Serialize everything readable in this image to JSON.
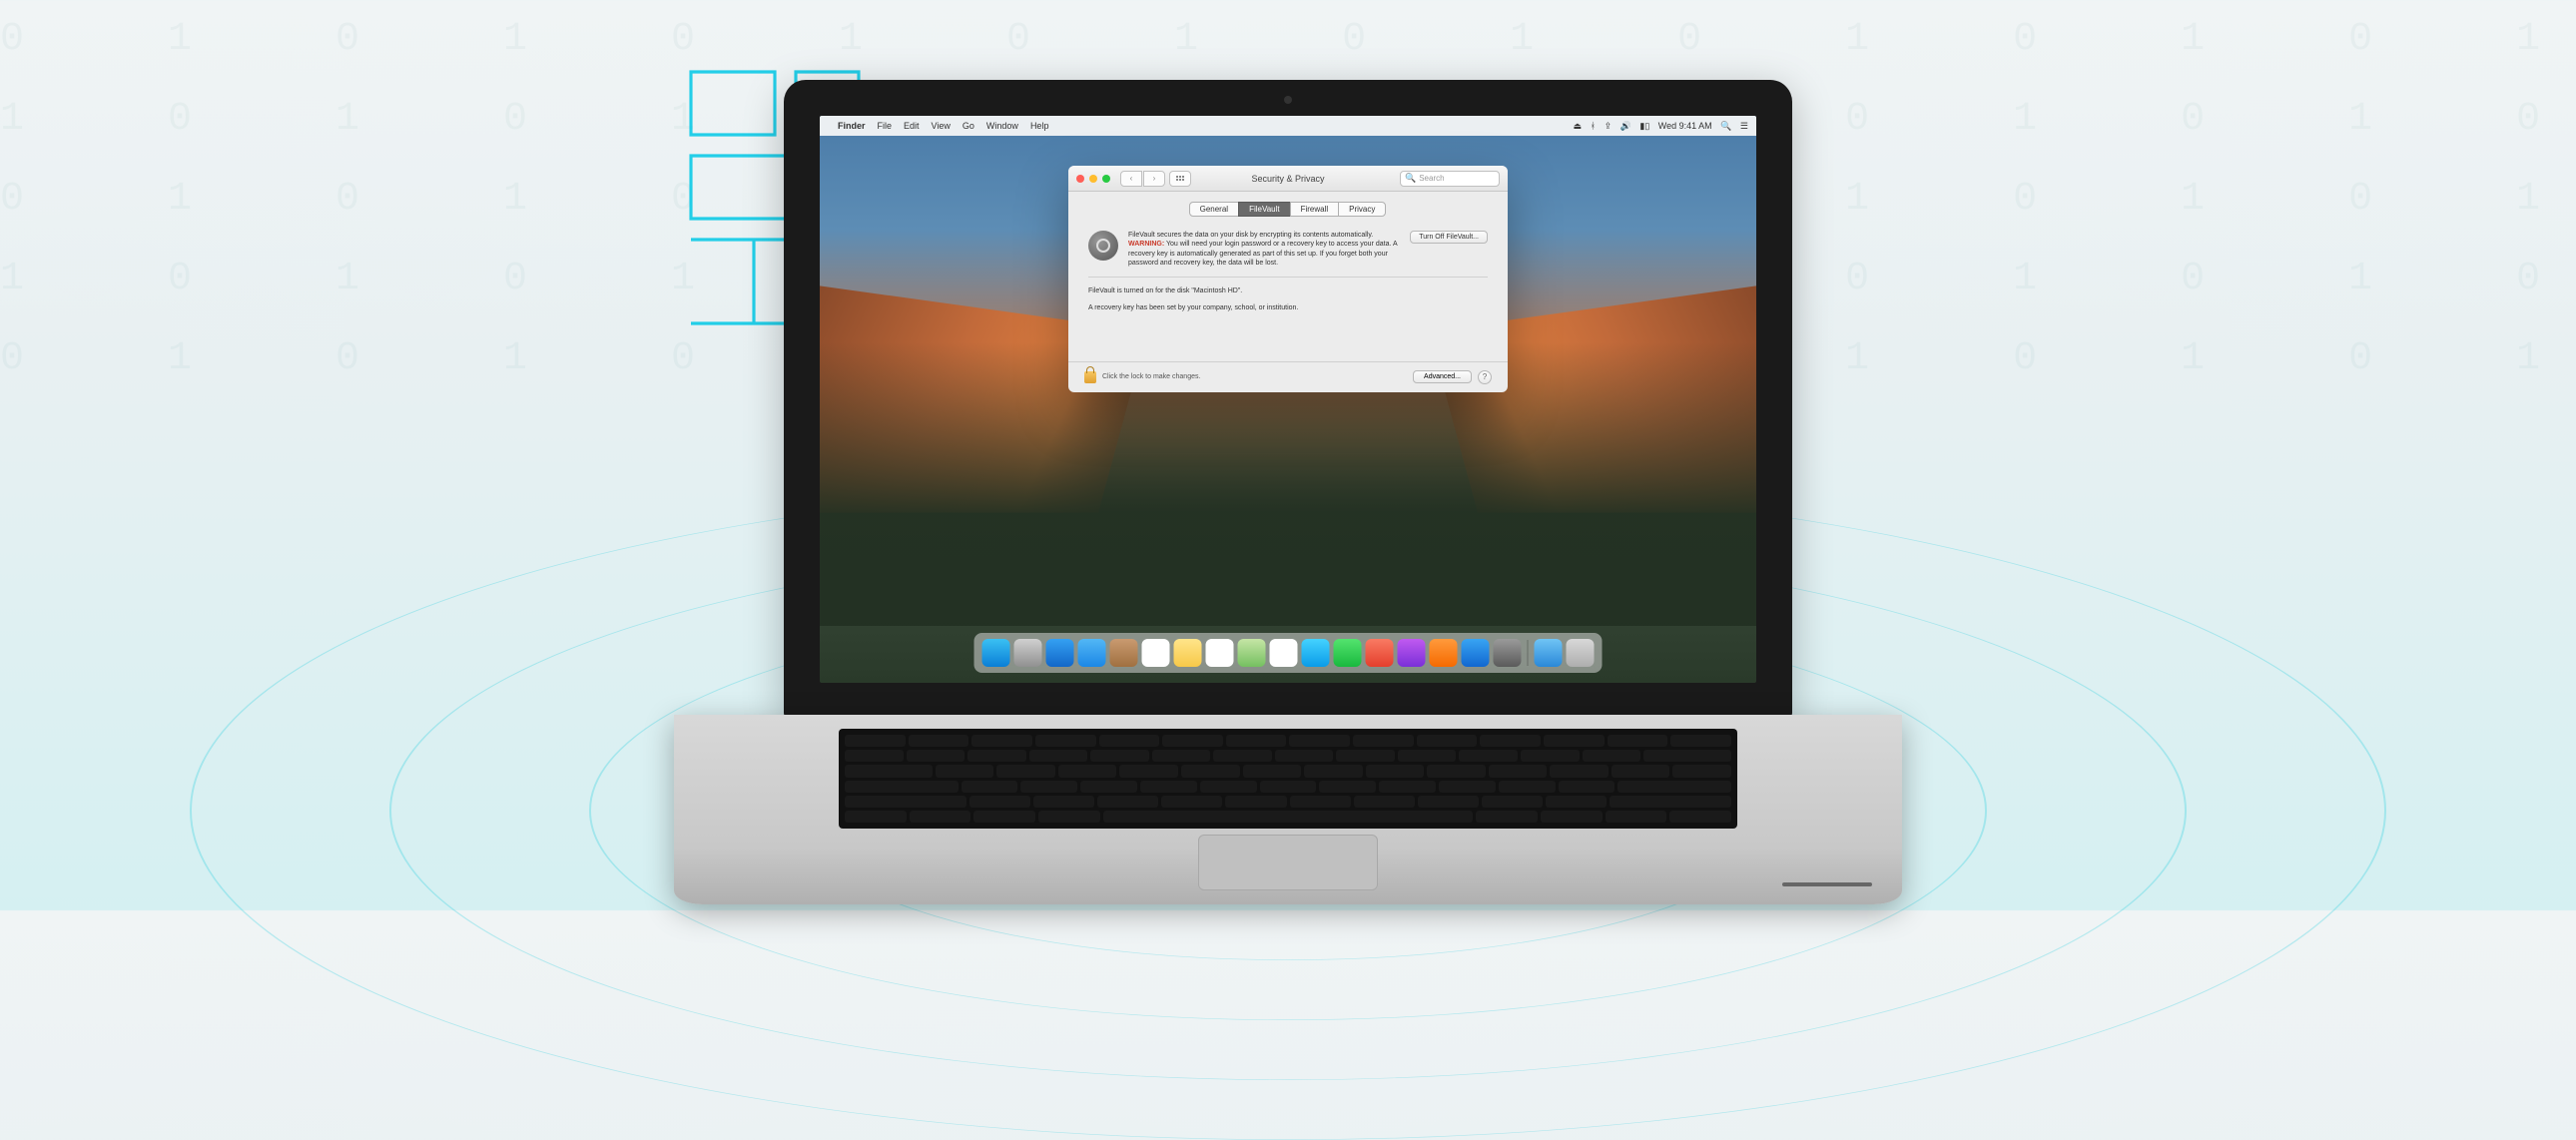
{
  "menubar": {
    "app": "Finder",
    "items": [
      "File",
      "Edit",
      "View",
      "Go",
      "Window",
      "Help"
    ],
    "clock": "Wed 9:41 AM"
  },
  "window": {
    "title": "Security & Privacy",
    "search_placeholder": "Search",
    "tabs": {
      "general": "General",
      "filevault": "FileVault",
      "firewall": "Firewall",
      "privacy": "Privacy"
    },
    "filevault_intro": "FileVault secures the data on your disk by encrypting its contents automatically.",
    "warning_label": "WARNING:",
    "warning_text": "You will need your login password or a recovery key to access your data. A recovery key is automatically generated as part of this set up. If you forget both your password and recovery key, the data will be lost.",
    "turn_off_label": "Turn Off FileVault...",
    "status_on": "FileVault is turned on for the disk \"Macintosh HD\".",
    "recovery_note": "A recovery key has been set by your company, school, or institution.",
    "lock_text": "Click the lock to make changes.",
    "advanced_label": "Advanced...",
    "help_label": "?"
  },
  "dock": {
    "items": [
      {
        "name": "finder",
        "color": "linear-gradient(#3ac0f3,#0a7ed6)"
      },
      {
        "name": "launchpad",
        "color": "linear-gradient(#d0d0d0,#909090)"
      },
      {
        "name": "safari",
        "color": "linear-gradient(#34a0f2,#1267c8)"
      },
      {
        "name": "mail",
        "color": "linear-gradient(#52b7f5,#1b87e6)"
      },
      {
        "name": "contacts",
        "color": "linear-gradient(#c99a70,#a07040)"
      },
      {
        "name": "calendar",
        "color": "#ffffff"
      },
      {
        "name": "notes",
        "color": "linear-gradient(#ffe58a,#f7c948)"
      },
      {
        "name": "reminders",
        "color": "#ffffff"
      },
      {
        "name": "maps",
        "color": "linear-gradient(#c5e5a5,#75c060)"
      },
      {
        "name": "photos",
        "color": "#ffffff"
      },
      {
        "name": "messages",
        "color": "linear-gradient(#44d2ff,#0a9be8)"
      },
      {
        "name": "facetime",
        "color": "linear-gradient(#53e36e,#19b93e)"
      },
      {
        "name": "photobooth",
        "color": "linear-gradient(#f97a63,#e43f2c)"
      },
      {
        "name": "itunes",
        "color": "linear-gradient(#c05af0,#7a2fd8)"
      },
      {
        "name": "ibooks",
        "color": "linear-gradient(#ff9a3c,#f56a00)"
      },
      {
        "name": "appstore",
        "color": "linear-gradient(#38a4f3,#1167d0)"
      },
      {
        "name": "preferences",
        "color": "linear-gradient(#9a9a9a,#5a5a5a)"
      }
    ],
    "after_sep": [
      {
        "name": "downloads",
        "color": "linear-gradient(#6fc4f5,#2a88d8)"
      },
      {
        "name": "trash",
        "color": "linear-gradient(#d8d8d8,#aeaeae)"
      }
    ]
  }
}
